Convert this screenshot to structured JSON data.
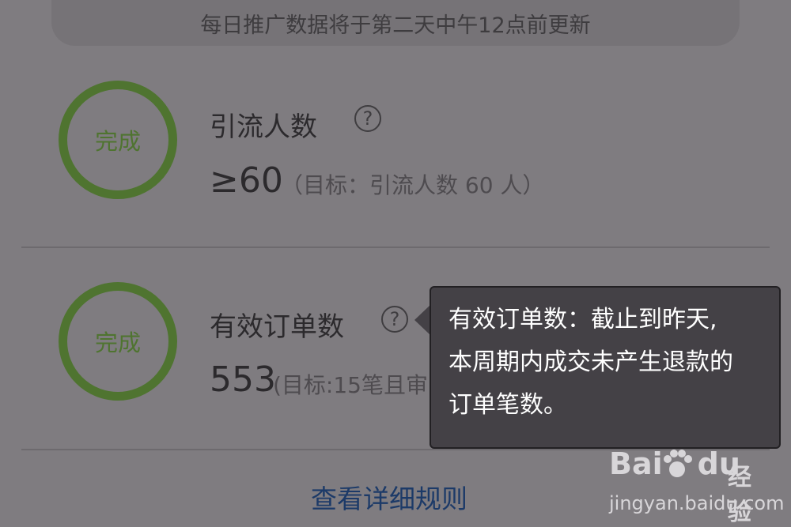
{
  "banner": {
    "text": "每日推广数据将于第二天中午12点前更新"
  },
  "metrics": [
    {
      "status": "完成",
      "title": "引流人数",
      "help_glyph": "?",
      "value": "≥60",
      "target": "（目标：引流人数 60 人）"
    },
    {
      "status": "完成",
      "title": "有效订单数",
      "help_glyph": "?",
      "value": "553",
      "target": "(目标:15笔且审"
    }
  ],
  "tooltip": {
    "lines": [
      "有效订单数：截止到昨天,",
      "本周期内成交未产生退款的",
      "订单笔数。"
    ]
  },
  "rules_link": {
    "label": "查看详细规则"
  },
  "watermark": {
    "brand": "Bai",
    "brand2": "du",
    "sub": "经验",
    "url": "jingyan.baidu.com"
  },
  "colors": {
    "complete_ring": "#4f7430",
    "link": "#1c3a68",
    "tooltip_bg": "#444146"
  }
}
